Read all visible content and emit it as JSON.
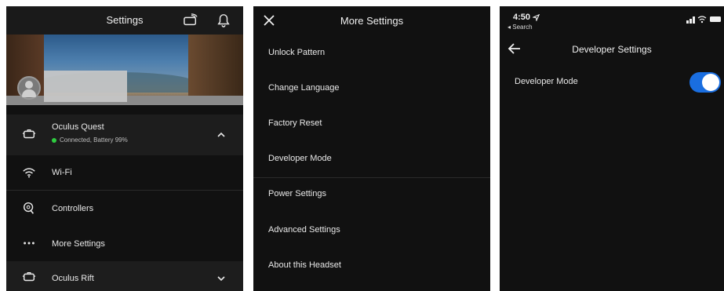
{
  "panel1": {
    "header": {
      "title": "Settings",
      "icons": [
        "cast-icon",
        "bell-icon"
      ]
    },
    "device_expanded": {
      "name": "Oculus Quest",
      "status": "Connected, Battery 99%",
      "status_color": "#2ecc40"
    },
    "items": [
      {
        "label": "Wi-Fi",
        "icon": "wifi-icon"
      },
      {
        "label": "Controllers",
        "icon": "controller-icon"
      },
      {
        "label": "More Settings",
        "icon": "more-icon"
      }
    ],
    "device_collapsed": {
      "name": "Oculus Rift"
    }
  },
  "panel2": {
    "header": {
      "title": "More Settings"
    },
    "items": [
      {
        "label": "Unlock Pattern"
      },
      {
        "label": "Change Language"
      },
      {
        "label": "Factory Reset"
      },
      {
        "label": "Developer Mode"
      },
      {
        "label": "Power Settings"
      },
      {
        "label": "Advanced Settings"
      },
      {
        "label": "About this Headset"
      }
    ]
  },
  "panel3": {
    "status_bar": {
      "time": "4:50",
      "back_label": "◂ Search"
    },
    "header": {
      "title": "Developer Settings"
    },
    "developer_mode": {
      "label": "Developer Mode",
      "enabled": true,
      "accent": "#1a6ee0"
    }
  }
}
